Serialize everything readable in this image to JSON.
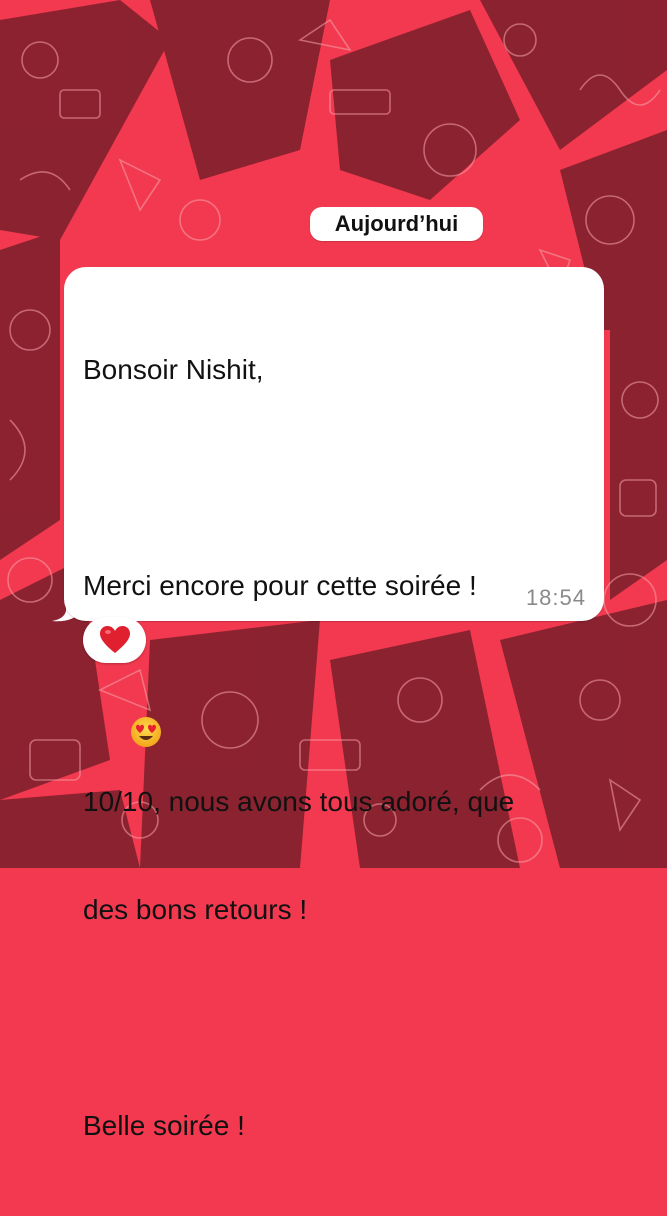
{
  "chat": {
    "date_separator": "Aujourd’hui",
    "message": {
      "lines": [
        "Bonsoir Nishit,",
        "",
        "Merci encore pour cette soirée !",
        "",
        "10/10, nous avons tous adoré, que",
        "des bons retours !",
        "",
        "Belle soirée !"
      ],
      "emoji": "heart-eyes-emoji",
      "time": "18:54"
    },
    "reaction": "heart-emoji"
  },
  "colors": {
    "wallpaper_red": "#f2394f",
    "wallpaper_dark": "#7a1f2a",
    "bubble_white": "#ffffff",
    "timestamp_gray": "#8a8a8a",
    "heart_red": "#e0202f"
  }
}
